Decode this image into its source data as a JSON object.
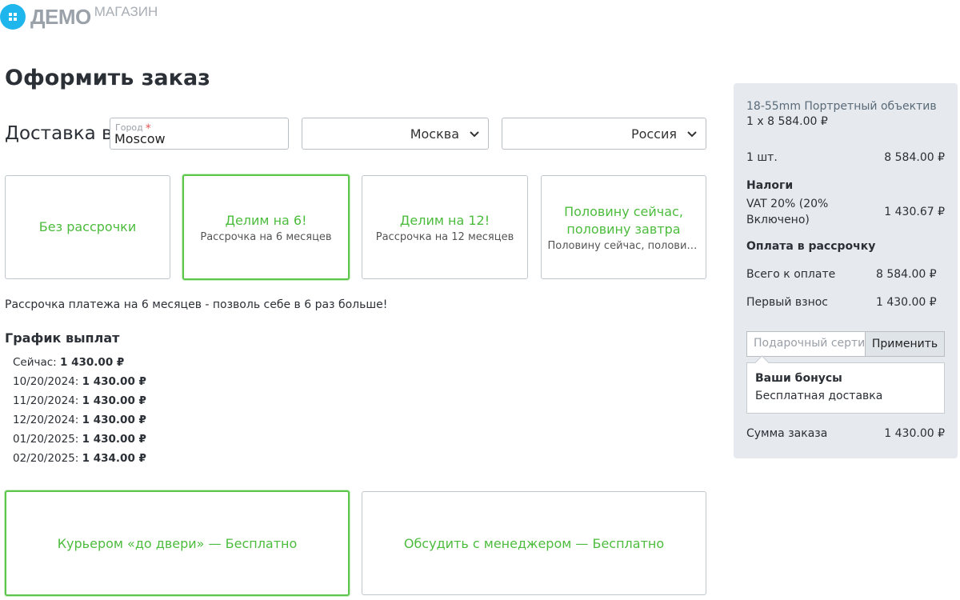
{
  "logo": {
    "main": "ДЕМО",
    "sub": "МАГАЗИН"
  },
  "page_title": "Оформить заказ",
  "delivery": {
    "label": "Доставка в",
    "city_field": {
      "caption": "Город",
      "required_mark": "*",
      "value": "Moscow"
    },
    "city_select": "Москва",
    "country_select": "Россия"
  },
  "installments": [
    {
      "title": "Без рассрочки",
      "subtitle": ""
    },
    {
      "title": "Делим на 6!",
      "subtitle": "Рассрочка на 6 месяцев"
    },
    {
      "title": "Делим на 12!",
      "subtitle": "Рассрочка на 12 месяцев"
    },
    {
      "title": "Половину сейчас, половину завтра",
      "subtitle": "Половину сейчас, половину..."
    }
  ],
  "promo_text": "Рассрочка платежа на 6 месяцев - позволь себе в 6 раз больше!",
  "schedule": {
    "title": "График выплат",
    "rows": [
      {
        "date": "Сейчас:",
        "amount": "1 430.00 ₽"
      },
      {
        "date": "10/20/2024:",
        "amount": "1 430.00 ₽"
      },
      {
        "date": "11/20/2024:",
        "amount": "1 430.00 ₽"
      },
      {
        "date": "12/20/2024:",
        "amount": "1 430.00 ₽"
      },
      {
        "date": "01/20/2025:",
        "amount": "1 430.00 ₽"
      },
      {
        "date": "02/20/2025:",
        "amount": "1 434.00 ₽"
      }
    ]
  },
  "delivery_methods": [
    {
      "label": "Курьером «до двери» — Бесплатно"
    },
    {
      "label": "Обсудить с менеджером — Бесплатно"
    }
  ],
  "summary": {
    "product_name": "18-55mm Портретный объектив",
    "qty_price": "1 x 8 584.00 ₽",
    "qty": "1 шт.",
    "qty_total": "8 584.00 ₽",
    "taxes_title": "Налоги",
    "vat_label": "VAT 20% (20% Включено)",
    "vat_value": "1 430.67 ₽",
    "installment_title": "Оплата в рассрочку",
    "total_label": "Всего к оплате",
    "total_value": "8 584.00 ₽",
    "first_label": "Первый взнос",
    "first_value": "1 430.00 ₽",
    "coupon_placeholder": "Подарочный сертификат",
    "apply_label": "Применить",
    "bonus_title": "Ваши бонусы",
    "bonus_text": "Бесплатная доставка",
    "order_sum_label": "Сумма заказа",
    "order_sum_value": "1 430.00 ₽"
  },
  "colors": {
    "accent_green": "#4cbc3d",
    "logo_blue": "#1fb6ee",
    "panel_bg": "#e6eaee"
  },
  "icons": [
    "logo-icon",
    "chevron-down-icon"
  ]
}
